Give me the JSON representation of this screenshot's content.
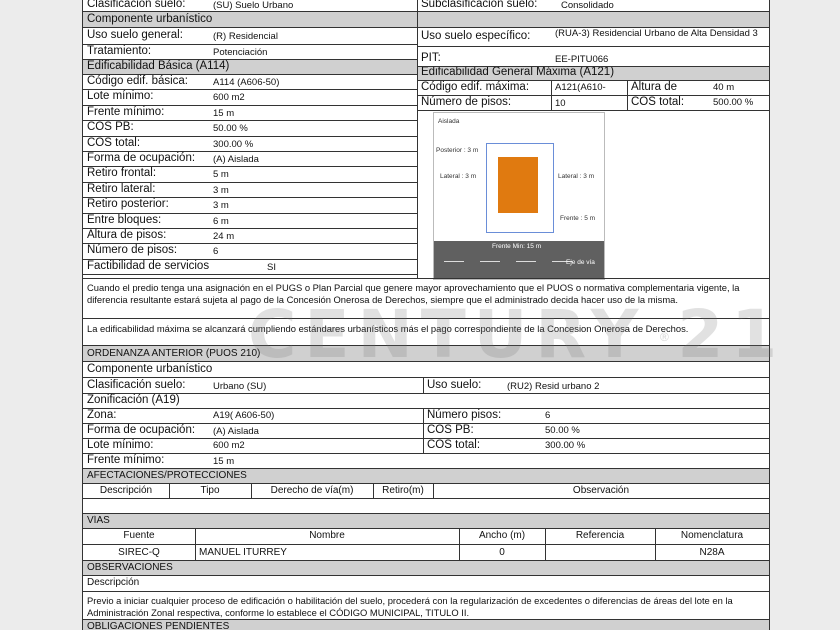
{
  "top": {
    "clasificacion_label": "Clasificación suelo:",
    "clasificacion_value": "(SU) Suelo Urbano",
    "subclasificacion_label": "Subclasificación suelo:",
    "subclasificacion_value": "Consolidado"
  },
  "componente": {
    "header": "Componente urbanístico",
    "uso_general_label": "Uso suelo general:",
    "uso_general_value": "(R) Residencial",
    "uso_especifico_label": "Uso suelo específico:",
    "uso_especifico_value": "(RUA-3) Residencial Urbano de Alta Densidad 3",
    "tratamiento_label": "Tratamiento:",
    "tratamiento_value": "Potenciación",
    "pit_label": "PIT:",
    "pit_value": "EE-PITU066"
  },
  "basica": {
    "header": "Edificabilidad Básica (A114)",
    "rows": [
      {
        "label": "Código edif. básica:",
        "value": "A114 (A606-50)"
      },
      {
        "label": "Lote mínimo:",
        "value": "600 m2"
      },
      {
        "label": "Frente mínimo:",
        "value": "15 m"
      },
      {
        "label": "COS PB:",
        "value": "50.00 %"
      },
      {
        "label": "COS total:",
        "value": "300.00 %"
      },
      {
        "label": "Forma de ocupación:",
        "value": "(A) Aislada"
      },
      {
        "label": "Retiro frontal:",
        "value": "5 m"
      },
      {
        "label": "Retiro lateral:",
        "value": "3 m"
      },
      {
        "label": "Retiro posterior:",
        "value": "3 m"
      },
      {
        "label": "Entre bloques:",
        "value": "6 m"
      },
      {
        "label": "Altura de pisos:",
        "value": "24 m"
      },
      {
        "label": "Número de pisos:",
        "value": "6"
      },
      {
        "label": "Factibilidad de servicios",
        "value": "SI"
      }
    ]
  },
  "maxima": {
    "header": "Edificabilidad General Máxima (A121)",
    "codigo_label": "Código edif. máxima:",
    "codigo_value": "A121(A610-",
    "altura_label": "Altura de",
    "altura_value": "40 m",
    "pisos_label": "Número de pisos:",
    "pisos_value": "10",
    "cos_label": "COS total:",
    "cos_value": "500.00 %"
  },
  "diagram": {
    "aislada": "Aislada",
    "posterior": "Posterior : 3 m",
    "lateral_left": "Lateral : 3 m",
    "lateral_right": "Lateral : 3 m",
    "frente": "Frente : 5 m",
    "frente_min": "Frente Min: 15 m",
    "eje_via": "Eje de vía",
    "building_color": "#e07a10",
    "road_color": "#606060"
  },
  "notes": {
    "note1": "Cuando el predio tenga una asignación en el PUGS o Plan Parcial que genere mayor aprovechamiento que el PUOS o normativa complementaria vigente, la diferencia resultante estará sujeta al pago de la Concesión Onerosa de Derechos, siempre que el administrado decida hacer uso de la misma.",
    "note2": "La edificabilidad máxima se alcanzará cumpliendo estándares urbanísticos más el pago correspondiente de la Concesion Onerosa de Derechos."
  },
  "watermark": "CENTURY 21",
  "watermark_reg": "®",
  "anterior": {
    "header": "ORDENANZA ANTERIOR (PUOS 210)",
    "componente": "Componente urbanístico",
    "clasificacion_label": "Clasificación suelo:",
    "clasificacion_value": "Urbano (SU)",
    "uso_label": "Uso suelo:",
    "uso_value": "(RU2) Resid urbano 2",
    "zonificacion": "Zonificación (A19)",
    "zona_label": "Zona:",
    "zona_value": "A19( A606-50)",
    "num_pisos_label": "Número pisos:",
    "num_pisos_value": "6",
    "forma_label": "Forma de ocupación:",
    "forma_value": "(A) Aislada",
    "cospb_label": "COS PB:",
    "cospb_value": "50.00 %",
    "lote_label": "Lote mínimo:",
    "lote_value": "600 m2",
    "costotal_label": "COS total:",
    "costotal_value": "300.00 %",
    "frente_label": "Frente mínimo:",
    "frente_value": "15 m"
  },
  "afectaciones": {
    "header": "AFECTACIONES/PROTECCIONES",
    "columns": [
      "Descripción",
      "Tipo",
      "Derecho de vía(m)",
      "Retiro(m)",
      "Observación"
    ]
  },
  "vias": {
    "header": "VÍAS",
    "columns": [
      "Fuente",
      "Nombre",
      "Ancho (m)",
      "Referencia",
      "Nomenclatura"
    ],
    "row": [
      "SIREC-Q",
      "MANUEL ITURREY",
      "0",
      "",
      "N28A"
    ]
  },
  "observaciones": {
    "header": "OBSERVACIONES",
    "descripcion": "Descripción",
    "text": "Previo a iniciar cualquier proceso de edificación o habilitación del suelo, procederá con la regularización de excedentes o diferencias de áreas del lote en la Administración Zonal respectiva, conforme lo establece el CÓDIGO MUNICIPAL, TITULO II."
  },
  "obligaciones": {
    "header": "OBLIGACIONES PENDIENTES"
  }
}
